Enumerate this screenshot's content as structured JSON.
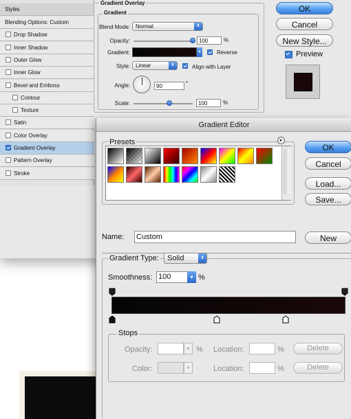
{
  "layer_style": {
    "left_panel": {
      "title": "Styles",
      "items": [
        {
          "label": "Blending Options: Custom",
          "checkbox": false,
          "checked": false,
          "highlight": false,
          "indent": false
        },
        {
          "label": "Drop Shadow",
          "checkbox": true,
          "checked": false,
          "highlight": false,
          "indent": false
        },
        {
          "label": "Inner Shadow",
          "checkbox": true,
          "checked": false,
          "highlight": false,
          "indent": false
        },
        {
          "label": "Outer Glow",
          "checkbox": true,
          "checked": false,
          "highlight": false,
          "indent": false
        },
        {
          "label": "Inner Glow",
          "checkbox": true,
          "checked": false,
          "highlight": false,
          "indent": false
        },
        {
          "label": "Bevel and Emboss",
          "checkbox": true,
          "checked": false,
          "highlight": false,
          "indent": false
        },
        {
          "label": "Contour",
          "checkbox": true,
          "checked": false,
          "highlight": false,
          "indent": true
        },
        {
          "label": "Texture",
          "checkbox": true,
          "checked": false,
          "highlight": false,
          "indent": true
        },
        {
          "label": "Satin",
          "checkbox": true,
          "checked": false,
          "highlight": false,
          "indent": false
        },
        {
          "label": "Color Overlay",
          "checkbox": true,
          "checked": false,
          "highlight": false,
          "indent": false
        },
        {
          "label": "Gradient Overlay",
          "checkbox": true,
          "checked": true,
          "highlight": true,
          "indent": false
        },
        {
          "label": "Pattern Overlay",
          "checkbox": true,
          "checked": false,
          "highlight": false,
          "indent": false
        },
        {
          "label": "Stroke",
          "checkbox": true,
          "checked": false,
          "highlight": false,
          "indent": false
        }
      ]
    },
    "overlay": {
      "section_title": "Gradient Overlay",
      "group_title": "Gradient",
      "blend_mode_label": "Blend Mode:",
      "blend_mode_value": "Normal",
      "opacity_label": "Opacity:",
      "opacity_value": "100",
      "opacity_unit": "%",
      "gradient_label": "Gradient:",
      "reverse_label": "Reverse",
      "reverse_checked": true,
      "style_label": "Style:",
      "style_value": "Linear",
      "align_label": "Align with Layer",
      "align_checked": true,
      "angle_label": "Angle:",
      "angle_value": "90",
      "angle_unit": "°",
      "scale_label": "Scale:",
      "scale_value": "100",
      "scale_unit": "%"
    },
    "buttons": {
      "ok": "OK",
      "cancel": "Cancel",
      "new_style": "New Style...",
      "preview": "Preview",
      "preview_checked": true
    }
  },
  "gradient_editor": {
    "title": "Gradient Editor",
    "presets_label": "Presets",
    "name_label": "Name:",
    "name_value": "Custom",
    "new_button": "New",
    "gradient_type_label": "Gradient Type:",
    "gradient_type_value": "Solid",
    "smoothness_label": "Smoothness:",
    "smoothness_value": "100",
    "smoothness_unit": "%",
    "stops_label": "Stops",
    "opacity_label": "Opacity:",
    "opacity_unit": "%",
    "location_label": "Location:",
    "location_unit": "%",
    "color_label": "Color:",
    "delete_label": "Delete",
    "buttons": {
      "ok": "OK",
      "cancel": "Cancel",
      "load": "Load...",
      "save": "Save..."
    }
  },
  "colors": {
    "accent": "#3a82dd",
    "highlight": "#b4cfea",
    "gradient_start": "#050505",
    "gradient_end": "#1a0808"
  }
}
